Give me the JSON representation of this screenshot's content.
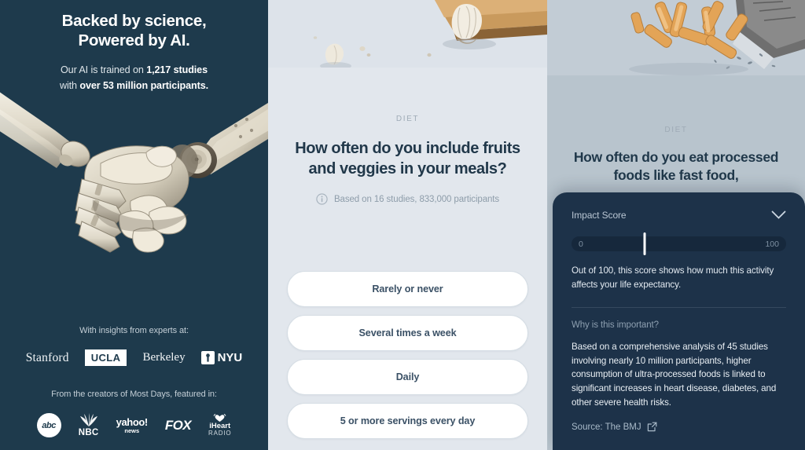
{
  "left_panel": {
    "title_line1": "Backed by science,",
    "title_line2": "Powered by AI.",
    "subtitle_prefix": "Our AI is trained on ",
    "subtitle_strong1": "1,217 studies",
    "subtitle_mid": "with ",
    "subtitle_strong2": "over 53 million participants.",
    "illustration": "robot-human-handshake-illustration",
    "experts_caption": "With insights from experts at:",
    "universities": [
      {
        "name": "Stanford"
      },
      {
        "name": "UCLA"
      },
      {
        "name": "Berkeley"
      },
      {
        "name": "NYU"
      }
    ],
    "media_caption": "From the creators of Most Days, featured in:",
    "media": [
      {
        "name": "abc"
      },
      {
        "name": "NBC"
      },
      {
        "name": "yahoo!",
        "sub": "news"
      },
      {
        "name": "FOX"
      },
      {
        "name": "iHeart",
        "sub": "RADIO"
      }
    ]
  },
  "middle_panel": {
    "illustration": "garlic-on-cutting-board-illustration",
    "kicker": "DIET",
    "question": "How often do you include fruits and veggies in your meals?",
    "meta": "Based on 16 studies, 833,000 participants",
    "answers": [
      "Rarely or never",
      "Several times a week",
      "Daily",
      "5 or more servings every day"
    ]
  },
  "right_panel": {
    "illustration": "french-fries-spilling-from-bag-illustration",
    "kicker": "DIET",
    "question": "How often do you eat processed foods like fast food,",
    "sheet": {
      "header_label": "Impact Score",
      "score_value": "34",
      "track_min": "0",
      "track_max": "100",
      "score_description": "Out of 100, this score shows how much this activity affects your life expectancy.",
      "why_label": "Why is this important?",
      "why_body": "Based on a comprehensive analysis of 45 studies involving nearly 10 million participants, higher consumption of ultra-processed foods is linked to significant increases in heart disease, diabetes, and other severe health risks.",
      "source": "Source: The BMJ"
    }
  },
  "colors": {
    "navy": "#1e3a4c",
    "sheet_navy": "#1d3249",
    "mid_bg": "#e2e7ed",
    "right_bg": "#b8c4cd",
    "text_dark": "#21384a"
  }
}
